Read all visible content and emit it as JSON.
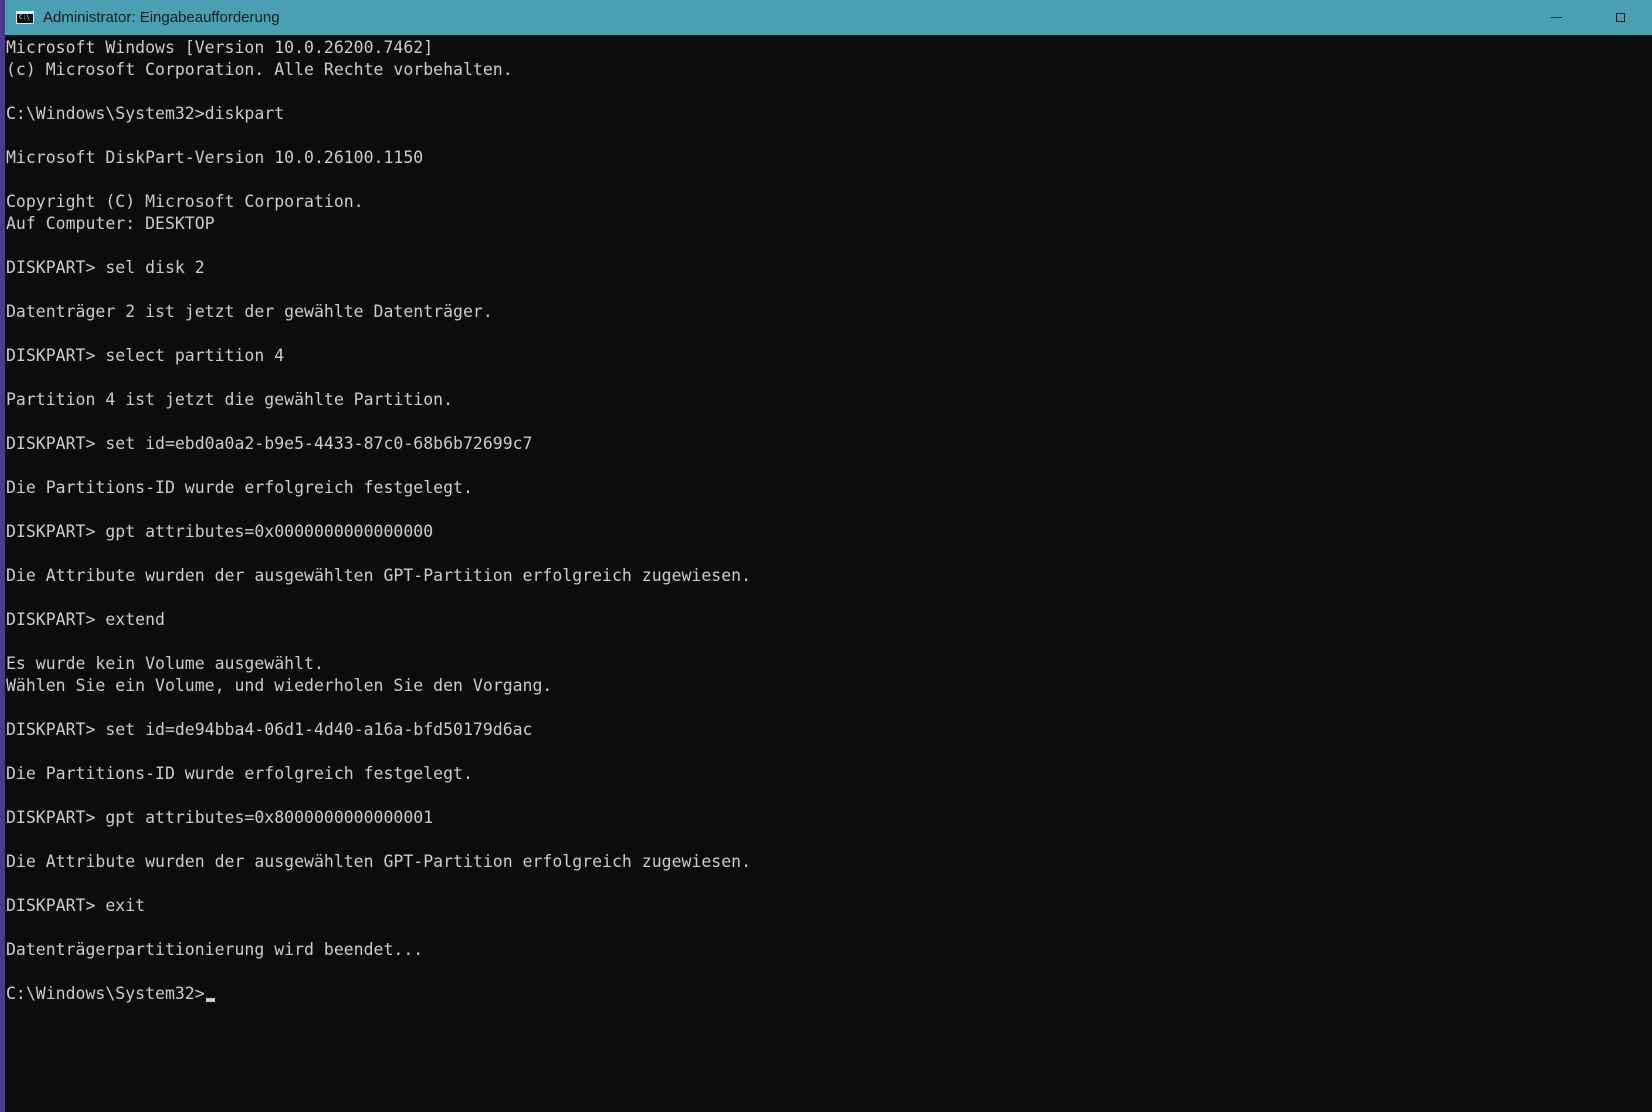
{
  "window": {
    "title": "Administrator: Eingabeaufforderung",
    "icon": "cmd-icon",
    "icon_text": "C:\\"
  },
  "colors": {
    "titlebar": "#4aa0b3",
    "background": "#0c0c0c",
    "text": "#cccccc"
  },
  "console": {
    "lines": [
      "Microsoft Windows [Version 10.0.26200.7462]",
      "(c) Microsoft Corporation. Alle Rechte vorbehalten.",
      "",
      "C:\\Windows\\System32>diskpart",
      "",
      "Microsoft DiskPart-Version 10.0.26100.1150",
      "",
      "Copyright (C) Microsoft Corporation.",
      "Auf Computer: DESKTOP",
      "",
      "DISKPART> sel disk 2",
      "",
      "Datenträger 2 ist jetzt der gewählte Datenträger.",
      "",
      "DISKPART> select partition 4",
      "",
      "Partition 4 ist jetzt die gewählte Partition.",
      "",
      "DISKPART> set id=ebd0a0a2-b9e5-4433-87c0-68b6b72699c7",
      "",
      "Die Partitions-ID wurde erfolgreich festgelegt.",
      "",
      "DISKPART> gpt attributes=0x0000000000000000",
      "",
      "Die Attribute wurden der ausgewählten GPT-Partition erfolgreich zugewiesen.",
      "",
      "DISKPART> extend",
      "",
      "Es wurde kein Volume ausgewählt.",
      "Wählen Sie ein Volume, und wiederholen Sie den Vorgang.",
      "",
      "DISKPART> set id=de94bba4-06d1-4d40-a16a-bfd50179d6ac",
      "",
      "Die Partitions-ID wurde erfolgreich festgelegt.",
      "",
      "DISKPART> gpt attributes=0x8000000000000001",
      "",
      "Die Attribute wurden der ausgewählten GPT-Partition erfolgreich zugewiesen.",
      "",
      "DISKPART> exit",
      "",
      "Datenträgerpartitionierung wird beendet...",
      ""
    ],
    "prompt": "C:\\Windows\\System32>"
  }
}
